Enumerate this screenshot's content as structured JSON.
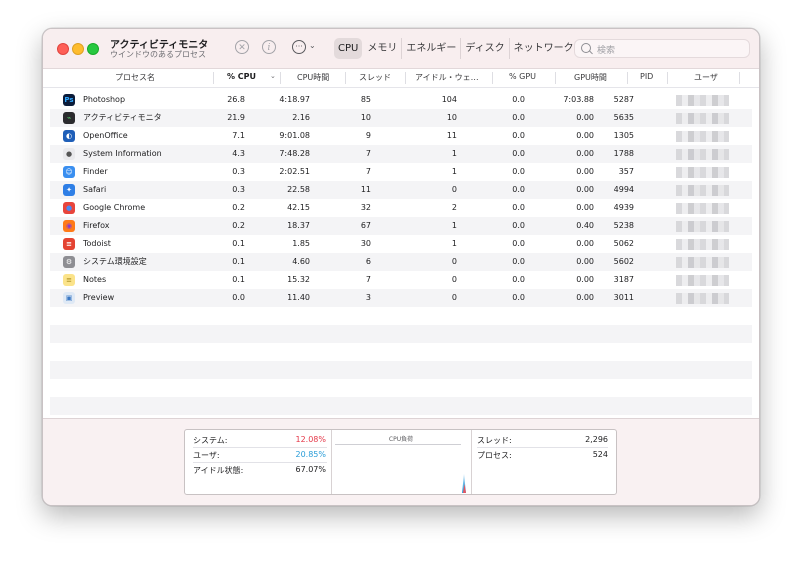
{
  "app": {
    "title": "アクティビティモニタ",
    "subtitle": "ウインドウのあるプロセス"
  },
  "toolbar": {
    "stop_icon": "xmark-circle-icon",
    "info_icon": "info-circle-icon",
    "more_icon": "ellipsis-circle-icon",
    "tabs": [
      {
        "label": "CPU",
        "active": true
      },
      {
        "label": "メモリ",
        "active": false
      },
      {
        "label": "エネルギー",
        "active": false
      },
      {
        "label": "ディスク",
        "active": false
      },
      {
        "label": "ネットワーク",
        "active": false
      }
    ],
    "search_placeholder": "検索"
  },
  "table": {
    "columns": [
      "プロセス名",
      "% CPU",
      "CPU時間",
      "スレッド",
      "アイドル・ウェ…",
      "% GPU",
      "GPU時間",
      "PID",
      "ユーザ"
    ],
    "sort_column": "% CPU",
    "rows": [
      {
        "name": "Photoshop",
        "icon": "photoshop-icon",
        "cpu": "26.8",
        "cpu_time": "4:18.97",
        "threads": "85",
        "idle_wake": "104",
        "gpu": "0.0",
        "gpu_time": "7:03.88",
        "pid": "5287"
      },
      {
        "name": "アクティビティモニタ",
        "icon": "activity-monitor-icon",
        "cpu": "21.9",
        "cpu_time": "2.16",
        "threads": "10",
        "idle_wake": "10",
        "gpu": "0.0",
        "gpu_time": "0.00",
        "pid": "5635"
      },
      {
        "name": "OpenOffice",
        "icon": "openoffice-icon",
        "cpu": "7.1",
        "cpu_time": "9:01.08",
        "threads": "9",
        "idle_wake": "11",
        "gpu": "0.0",
        "gpu_time": "0.00",
        "pid": "1305"
      },
      {
        "name": "System Information",
        "icon": "system-information-icon",
        "cpu": "4.3",
        "cpu_time": "7:48.28",
        "threads": "7",
        "idle_wake": "1",
        "gpu": "0.0",
        "gpu_time": "0.00",
        "pid": "1788"
      },
      {
        "name": "Finder",
        "icon": "finder-icon",
        "cpu": "0.3",
        "cpu_time": "2:02.51",
        "threads": "7",
        "idle_wake": "1",
        "gpu": "0.0",
        "gpu_time": "0.00",
        "pid": "357"
      },
      {
        "name": "Safari",
        "icon": "safari-icon",
        "cpu": "0.3",
        "cpu_time": "22.58",
        "threads": "11",
        "idle_wake": "0",
        "gpu": "0.0",
        "gpu_time": "0.00",
        "pid": "4994"
      },
      {
        "name": "Google Chrome",
        "icon": "chrome-icon",
        "cpu": "0.2",
        "cpu_time": "42.15",
        "threads": "32",
        "idle_wake": "2",
        "gpu": "0.0",
        "gpu_time": "0.00",
        "pid": "4939"
      },
      {
        "name": "Firefox",
        "icon": "firefox-icon",
        "cpu": "0.2",
        "cpu_time": "18.37",
        "threads": "67",
        "idle_wake": "1",
        "gpu": "0.0",
        "gpu_time": "0.40",
        "pid": "5238"
      },
      {
        "name": "Todoist",
        "icon": "todoist-icon",
        "cpu": "0.1",
        "cpu_time": "1.85",
        "threads": "30",
        "idle_wake": "1",
        "gpu": "0.0",
        "gpu_time": "0.00",
        "pid": "5062"
      },
      {
        "name": "システム環境設定",
        "icon": "system-preferences-icon",
        "cpu": "0.1",
        "cpu_time": "4.60",
        "threads": "6",
        "idle_wake": "0",
        "gpu": "0.0",
        "gpu_time": "0.00",
        "pid": "5602"
      },
      {
        "name": "Notes",
        "icon": "notes-icon",
        "cpu": "0.1",
        "cpu_time": "15.32",
        "threads": "7",
        "idle_wake": "0",
        "gpu": "0.0",
        "gpu_time": "0.00",
        "pid": "3187"
      },
      {
        "name": "Preview",
        "icon": "preview-icon",
        "cpu": "0.0",
        "cpu_time": "11.40",
        "threads": "3",
        "idle_wake": "0",
        "gpu": "0.0",
        "gpu_time": "0.00",
        "pid": "3011"
      }
    ]
  },
  "summary": {
    "system_label": "システム:",
    "system_value": "12.08%",
    "user_label": "ユーザ:",
    "user_value": "20.85%",
    "idle_label": "アイドル状態:",
    "idle_value": "67.07%",
    "graph_title": "CPU負荷",
    "threads_label": "スレッド:",
    "threads_value": "2,296",
    "processes_label": "プロセス:",
    "processes_value": "524"
  },
  "colors": {
    "system": "#e5394a",
    "user": "#2a9dd8",
    "titlebar": "#f8eeef"
  }
}
